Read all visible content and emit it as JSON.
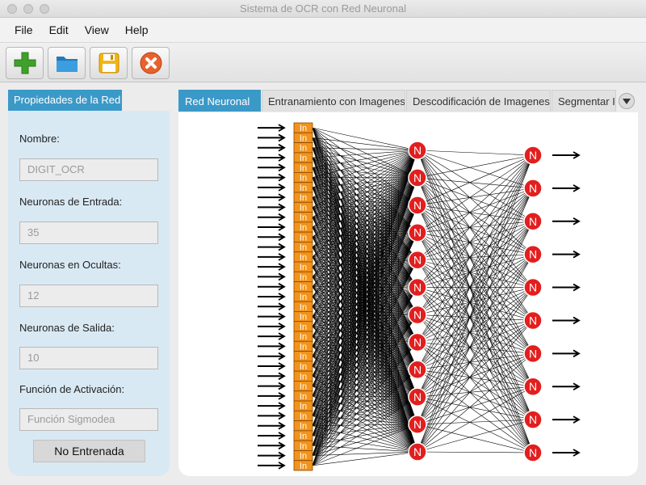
{
  "window": {
    "title": "Sistema de OCR con Red Neuronal"
  },
  "menu": [
    "File",
    "Edit",
    "View",
    "Help"
  ],
  "toolbar": {
    "buttons": [
      {
        "name": "new",
        "icon": "plus-icon",
        "color": "#3fa12a"
      },
      {
        "name": "open",
        "icon": "folder-icon",
        "color": "#2f8fd0"
      },
      {
        "name": "save",
        "icon": "floppy-disk-icon",
        "color": "#f2b515"
      },
      {
        "name": "close",
        "icon": "close-icon",
        "color": "#e8622e"
      }
    ]
  },
  "left_panel": {
    "tab_label": "Propiedades de la Red",
    "fields": [
      {
        "label": "Nombre:",
        "value": "DIGIT_OCR"
      },
      {
        "label": "Neuronas de Entrada:",
        "value": "35"
      },
      {
        "label": "Neuronas en Ocultas:",
        "value": "12"
      },
      {
        "label": "Neuronas de Salida:",
        "value": "10"
      },
      {
        "label": "Función de Activación:",
        "value": "Función Sigmodea"
      }
    ],
    "status_button": "No Entrenada"
  },
  "tabs": [
    "Red Neuronal",
    "Entranamiento con Imagenes",
    "Descodificación de Imagenes",
    "Segmentar Im"
  ],
  "network": {
    "input_count": 35,
    "hidden_count": 12,
    "output_count": 10,
    "input_label": "In",
    "neuron_label": "N",
    "colors": {
      "input": "#f3931b",
      "neuron": "#e31e1e",
      "accent": "#3b99c7"
    }
  }
}
